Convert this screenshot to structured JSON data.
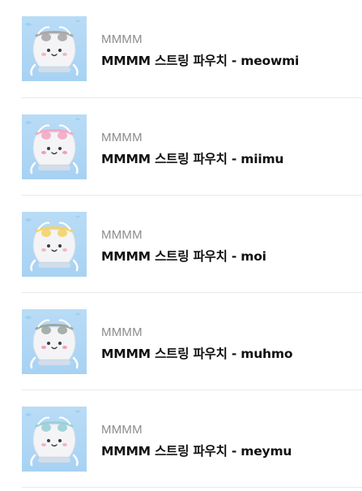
{
  "products": [
    {
      "brand": "MMMM",
      "title": "MMMM 스트링 파우치 - meowmi",
      "image": "meowmi-pouch-image",
      "accent": "#a9a9a9",
      "cheek": "#f2b7c7"
    },
    {
      "brand": "MMMM",
      "title": "MMMM 스트링 파우치 - miimu",
      "image": "miimu-pouch-image",
      "accent": "#f3a9c4",
      "cheek": "#f49ab8"
    },
    {
      "brand": "MMMM",
      "title": "MMMM 스트링 파우치 - moi",
      "image": "moi-pouch-image",
      "accent": "#f2d36a",
      "cheek": "#f3b8c6"
    },
    {
      "brand": "MMMM",
      "title": "MMMM 스트링 파우치 - muhmo",
      "image": "muhmo-pouch-image",
      "accent": "#9ea8a2",
      "cheek": "#f0a0b6"
    },
    {
      "brand": "MMMM",
      "title": "MMMM 스트링 파우치 - meymu",
      "image": "meymu-pouch-image",
      "accent": "#9ccfd8",
      "cheek": "#f3b4c5"
    }
  ]
}
